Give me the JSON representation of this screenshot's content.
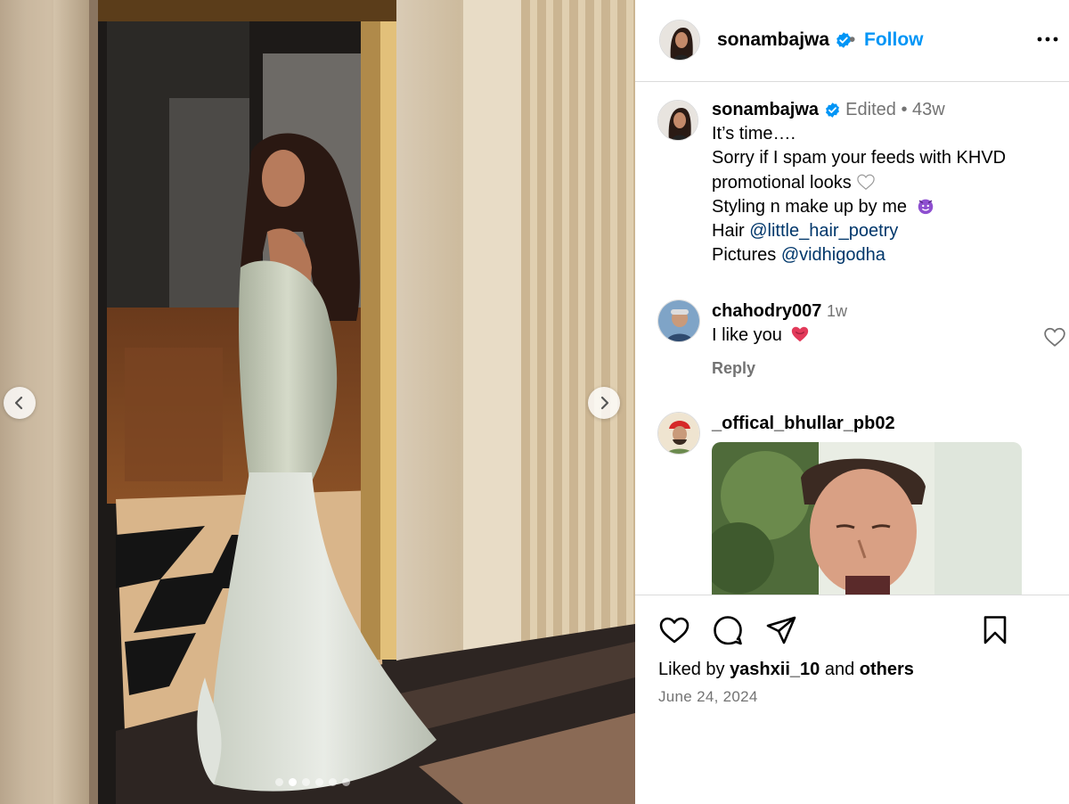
{
  "post": {
    "author": "sonambajwa",
    "follow_label": "Follow",
    "separator": "•"
  },
  "caption": {
    "username": "sonambajwa",
    "edited": "Edited",
    "dot": "•",
    "age": "43w",
    "line1": "It’s time….",
    "line2": "Sorry if I spam your feeds with KHVD promotional looks",
    "line3": "Styling n make up by me",
    "hair_label": "Hair",
    "hair_mention": "@little_hair_poetry",
    "pictures_label": "Pictures",
    "pictures_mention": "@vidhigodha"
  },
  "comments": [
    {
      "username": "chahodry007",
      "time": "1w",
      "text": "I like you",
      "reply_label": "Reply"
    },
    {
      "username": "_offical_bhullar_pb02",
      "time": "",
      "text": "",
      "reply_label": ""
    }
  ],
  "carousel": {
    "slide_count": 6,
    "active_index": 1
  },
  "footer": {
    "liked_prefix": "Liked by",
    "liked_user": "yashxii_10",
    "liked_and": "and",
    "liked_others": "others",
    "date": "June 24, 2024"
  },
  "colors": {
    "link": "#0095f6",
    "mention": "#00376b",
    "muted": "#737373",
    "verified": "#0095f6"
  },
  "icons": [
    "more-icon",
    "verified-icon",
    "heart-icon",
    "comment-icon",
    "share-icon",
    "bookmark-icon",
    "chevron-left-icon",
    "chevron-right-icon"
  ]
}
